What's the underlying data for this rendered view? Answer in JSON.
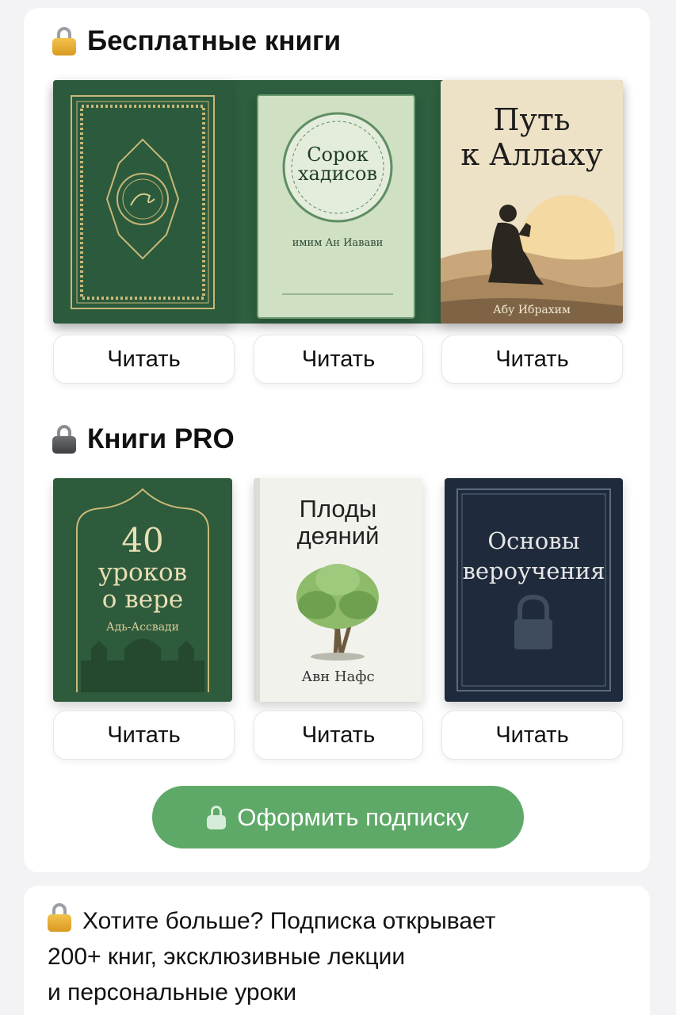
{
  "free_section": {
    "title": "Бесплатные книги",
    "books": [
      {
        "cover_title": "",
        "author": "",
        "button": "Читать"
      },
      {
        "cover_title_line1": "Сорок",
        "cover_title_line2": "хадисов",
        "author": "имим Ан Иавави",
        "button": "Читать"
      },
      {
        "cover_title_line1": "Путь",
        "cover_title_line2": "к Аллаху",
        "author": "Абу Ибрахим",
        "button": "Читать"
      }
    ]
  },
  "pro_section": {
    "title": "Книги PRO",
    "books": [
      {
        "cover_title_line1": "40",
        "cover_title_line2": "уроков",
        "cover_title_line3": "о вере",
        "author": "Адь-Ассвади",
        "button": "Читать"
      },
      {
        "cover_title_line1": "Плоды",
        "cover_title_line2": "деяний",
        "author": "Авн Нафс",
        "button": "Читать"
      },
      {
        "cover_title_line1": "Основы",
        "cover_title_line2": "вероучения",
        "author": "",
        "button": "Читать"
      }
    ]
  },
  "subscribe": {
    "label": "Оформить подписку"
  },
  "promo": {
    "line1": "Хотите больше? Подписка открывает",
    "line2": "200+ книг, эксклюзивные лекции",
    "line3": "и персональные уроки"
  },
  "colors": {
    "accent_green": "#5fa968",
    "cover_green": "#2d5e3e",
    "cover_navy": "#1f2b3d"
  }
}
